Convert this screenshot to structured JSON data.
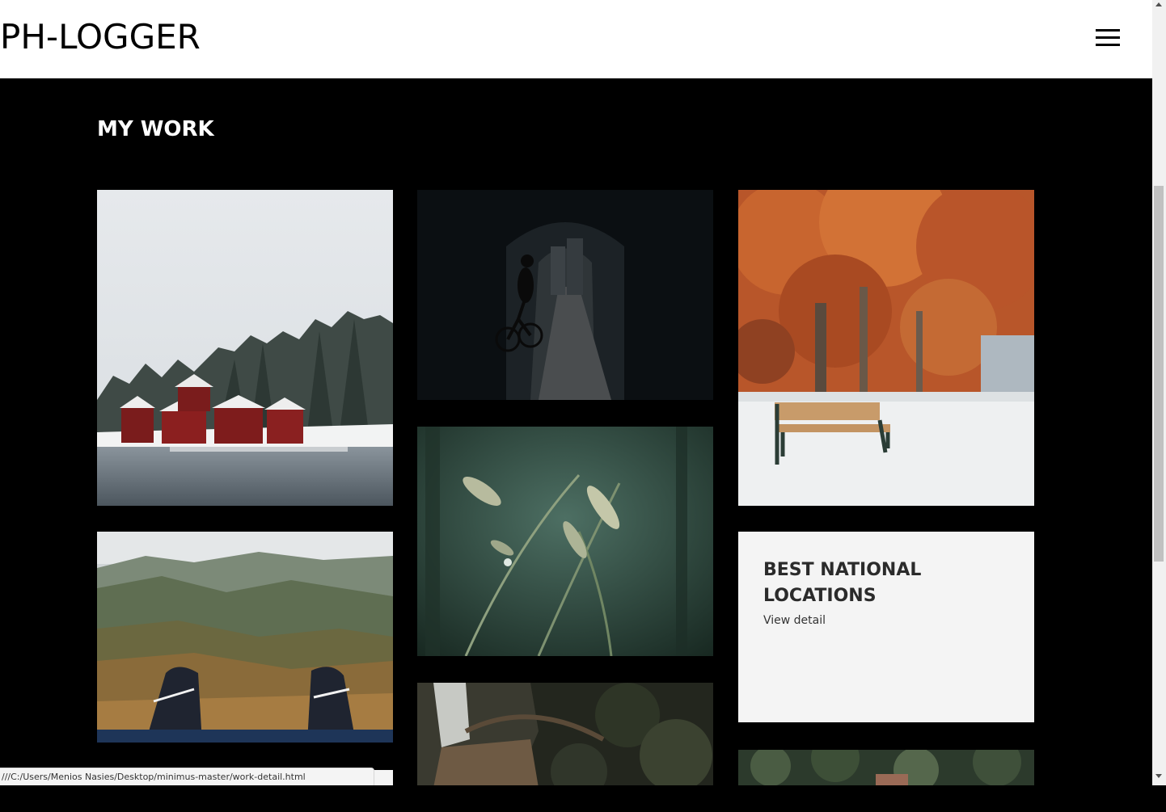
{
  "header": {
    "logo": "PH-LOGGER",
    "menu_icon": "hamburger-menu-icon"
  },
  "main": {
    "section_title": "MY WORK",
    "card": {
      "title": "BEST NATIONAL LOCATIONS",
      "link": "View detail"
    }
  },
  "status_bar": {
    "url": "///C:/Users/Menios Nasies/Desktop/minimus-master/work-detail.html"
  },
  "colors": {
    "header_bg": "#ffffff",
    "page_bg": "#000000",
    "card_bg": "#f4f4f4"
  }
}
